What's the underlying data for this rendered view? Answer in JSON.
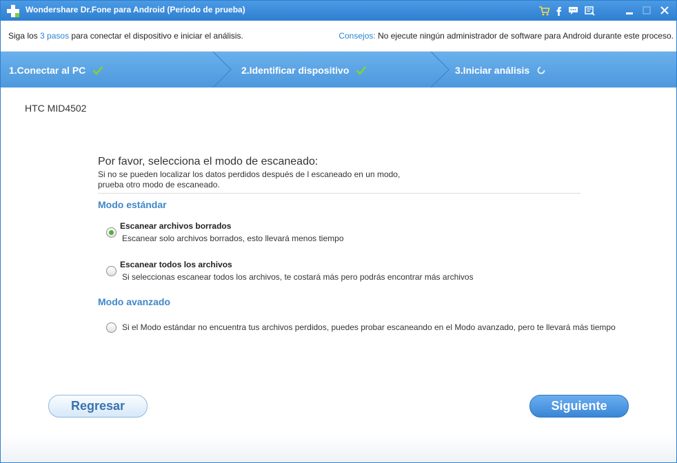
{
  "window": {
    "title": "Wondershare Dr.Fone para Android (Periodo de prueba)"
  },
  "infobar": {
    "left_prefix": "Siga los",
    "left_link": "3 pasos",
    "left_suffix": "para conectar el dispositivo e iniciar el análisis.",
    "tips_label": "Consejos:",
    "tips_text": "No ejecute ningún administrador de software para Android durante este proceso."
  },
  "steps": [
    {
      "label": "1.Conectar al PC",
      "status": "done"
    },
    {
      "label": "2.Identificar dispositivo",
      "status": "done"
    },
    {
      "label": "3.Iniciar análisis",
      "status": "in-progress"
    }
  ],
  "device": {
    "name": "HTC MID4502"
  },
  "scan": {
    "heading": "Por favor, selecciona el modo de escaneado:",
    "desc_line1": "Si no se pueden localizar los datos perdidos después de l escaneado en un modo,",
    "desc_line2": "prueba otro modo de escaneado.",
    "standard_mode": "Modo estándar",
    "advanced_mode": "Modo avanzado",
    "options": [
      {
        "title": "Escanear archivos borrados",
        "desc": "Escanear solo archivos borrados, esto llevará menos tiempo",
        "selected": true
      },
      {
        "title": "Escanear todos los archivos",
        "desc": "Si seleccionas escanear todos los archivos, te costará más pero podrás encontrar más archivos",
        "selected": false
      },
      {
        "title": "",
        "desc": "Si el Modo estándar no encuentra tus archivos perdidos, puedes probar escaneando en el Modo avanzado, pero te llevará más tiempo",
        "selected": false
      }
    ]
  },
  "buttons": {
    "back": "Regresar",
    "next": "Siguiente"
  },
  "colors": {
    "titlebar": "#3a8ddb",
    "steps_bar": "#5aa3e4",
    "link_blue": "#2a82d0",
    "mode_heading": "#3f87c9",
    "check_green": "#7fd13b",
    "radio_selected": "#4fb334"
  },
  "icons": [
    "plus-logo-icon",
    "cart-icon",
    "facebook-icon",
    "chat-icon",
    "feedback-icon",
    "minimize-icon",
    "maximize-icon",
    "close-icon",
    "checkmark-icon",
    "spinner-icon"
  ]
}
